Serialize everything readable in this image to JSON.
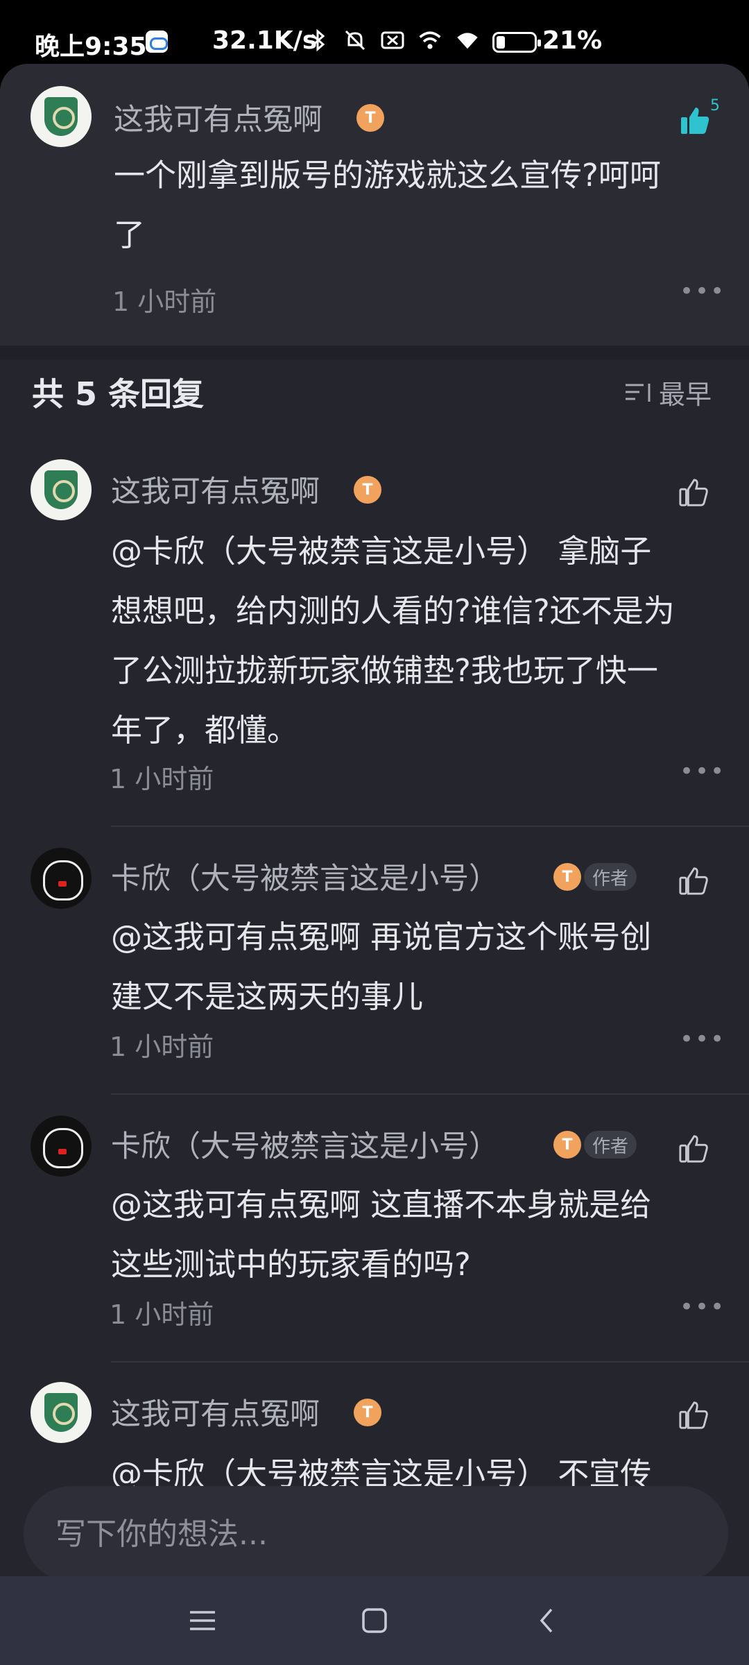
{
  "status_bar": {
    "time": "晚上9:35",
    "net_speed": "32.1K/s",
    "battery_pct": "21%",
    "icons": [
      "cloud-app-icon",
      "bluetooth-icon",
      "mute-icon",
      "sim-off-icon",
      "signal-icon",
      "wifi-icon",
      "battery-icon"
    ]
  },
  "parent_comment": {
    "username": "这我可有点冤啊",
    "badge": "T",
    "content_line1": "一个刚拿到版号的游戏就这么宣传?呵呵",
    "content_line2": "了",
    "time": "1 小时前",
    "likes": "5",
    "liked": true
  },
  "replies_header": {
    "title": "共 5 条回复",
    "sort_icon": "sort-icon",
    "sort_label": "最早"
  },
  "replies": [
    {
      "username": "这我可有点冤啊",
      "badge": "T",
      "lines": [
        "@卡欣（大号被禁言这是小号）  拿脑子",
        "想想吧，给内测的人看的?谁信?还不是为",
        "了公测拉拢新玩家做铺垫?我也玩了快一",
        "年了，都懂。"
      ],
      "time": "1 小时前"
    },
    {
      "username": "卡欣（大号被禁言这是小号）",
      "badge": "T",
      "author_tag": "作者",
      "lines": [
        "@这我可有点冤啊  再说官方这个账号创",
        "建又不是这两天的事儿"
      ],
      "time": "1 小时前"
    },
    {
      "username": "卡欣（大号被禁言这是小号）",
      "badge": "T",
      "author_tag": "作者",
      "lines": [
        "@这我可有点冤啊  这直播不本身就是给",
        "这些测试中的玩家看的吗?"
      ],
      "time": "1 小时前"
    },
    {
      "username": "这我可有点冤啊",
      "badge": "T",
      "lines": [
        "@卡欣（大号被禁言这是小号）  不宣传"
      ]
    }
  ],
  "input": {
    "placeholder": "写下你的想法..."
  },
  "nav": {
    "items": [
      "menu-icon",
      "home-icon",
      "back-icon"
    ]
  },
  "colors": {
    "sheet_bg": "#24252d",
    "accent_like": "#2fc3d0",
    "badge_orange": "#f1a25c"
  }
}
